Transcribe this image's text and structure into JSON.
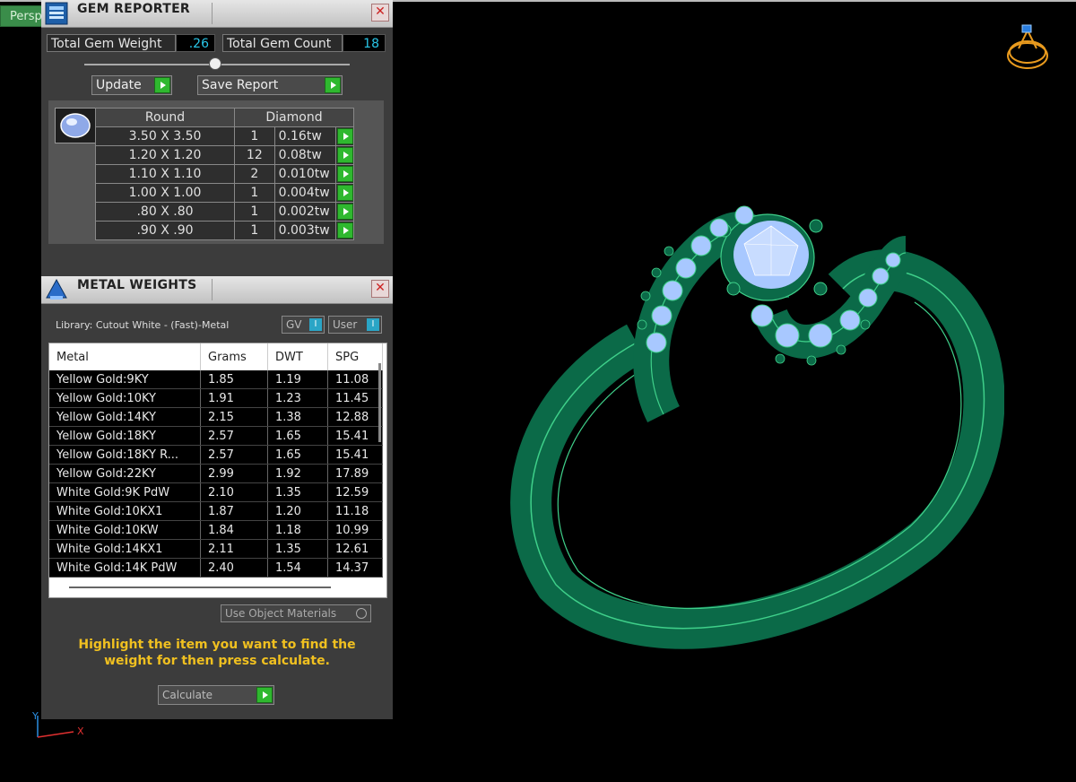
{
  "viewport": {
    "tab_label": "Persp"
  },
  "gem_reporter": {
    "title": "GEM REPORTER",
    "close_glyph": "✕",
    "total_weight_label": "Total Gem Weight",
    "total_weight_value": ".26",
    "total_count_label": "Total Gem Count",
    "total_count_value": "18",
    "update_label": "Update",
    "save_report_label": "Save Report",
    "table": {
      "shape": "Round",
      "material": "Diamond",
      "rows": [
        {
          "size": "3.50 X 3.50",
          "count": "1",
          "weight": "0.16tw"
        },
        {
          "size": "1.20 X 1.20",
          "count": "12",
          "weight": "0.08tw"
        },
        {
          "size": "1.10 X 1.10",
          "count": "2",
          "weight": "0.010tw"
        },
        {
          "size": "1.00 X 1.00",
          "count": "1",
          "weight": "0.004tw"
        },
        {
          "size": ".80 X .80",
          "count": "1",
          "weight": "0.002tw"
        },
        {
          "size": ".90 X .90",
          "count": "1",
          "weight": "0.003tw"
        }
      ]
    }
  },
  "metal_weights": {
    "title": "METAL WEIGHTS",
    "close_glyph": "✕",
    "library_text": "Library: Cutout White - (Fast)-Metal",
    "gv_label": "GV",
    "user_label": "User",
    "columns": [
      "Metal",
      "Grams",
      "DWT",
      "SPG"
    ],
    "rows": [
      {
        "metal": "Yellow Gold:9KY",
        "grams": "1.85",
        "dwt": "1.19",
        "spg": "11.08"
      },
      {
        "metal": "Yellow Gold:10KY",
        "grams": "1.91",
        "dwt": "1.23",
        "spg": "11.45"
      },
      {
        "metal": "Yellow Gold:14KY",
        "grams": "2.15",
        "dwt": "1.38",
        "spg": "12.88"
      },
      {
        "metal": "Yellow Gold:18KY",
        "grams": "2.57",
        "dwt": "1.65",
        "spg": "15.41"
      },
      {
        "metal": "Yellow Gold:18KY R...",
        "grams": "2.57",
        "dwt": "1.65",
        "spg": "15.41"
      },
      {
        "metal": "Yellow Gold:22KY",
        "grams": "2.99",
        "dwt": "1.92",
        "spg": "17.89"
      },
      {
        "metal": "White Gold:9K PdW",
        "grams": "2.10",
        "dwt": "1.35",
        "spg": "12.59"
      },
      {
        "metal": "White Gold:10KX1",
        "grams": "1.87",
        "dwt": "1.20",
        "spg": "11.18"
      },
      {
        "metal": "White Gold:10KW",
        "grams": "1.84",
        "dwt": "1.18",
        "spg": "10.99"
      },
      {
        "metal": "White Gold:14KX1",
        "grams": "2.11",
        "dwt": "1.35",
        "spg": "12.61"
      },
      {
        "metal": "White Gold:14K PdW",
        "grams": "2.40",
        "dwt": "1.54",
        "spg": "14.37"
      }
    ],
    "use_object_materials_label": "Use Object Materials",
    "hint_text": "Highlight the item you want to find the weight for then press calculate.",
    "calculate_label": "Calculate"
  },
  "axes": {
    "y": "Y",
    "x": "X"
  },
  "colors": {
    "ring": "#0b6a48",
    "ring_edge": "#3fd08a",
    "gem": "#a8c8ff",
    "accent_cyan": "#29c6e8",
    "go_green": "#2fb82f",
    "hint_yellow": "#f0c020"
  }
}
